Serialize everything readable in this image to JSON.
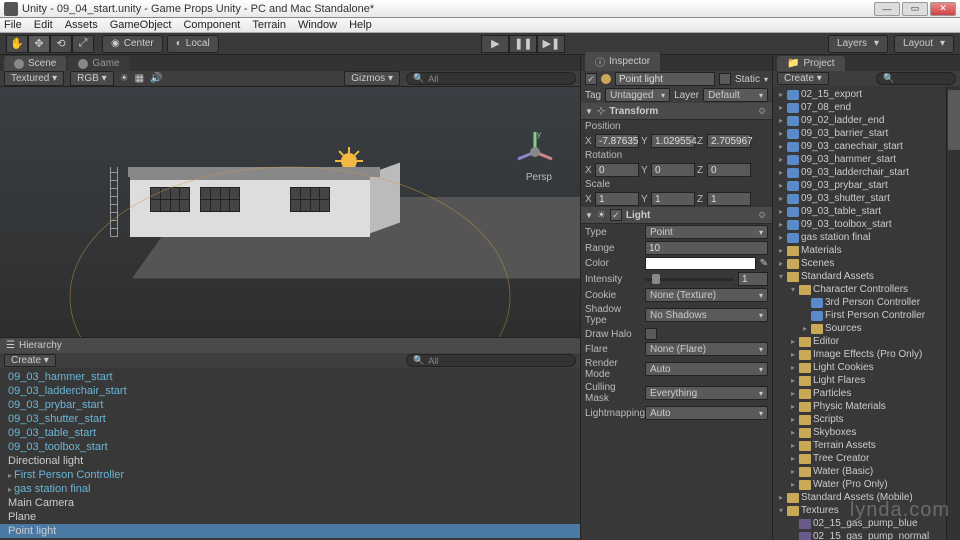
{
  "window": {
    "title": "Unity - 09_04_start.unity - Game Props Unity - PC and Mac Standalone*"
  },
  "menu": [
    "File",
    "Edit",
    "Assets",
    "GameObject",
    "Component",
    "Terrain",
    "Window",
    "Help"
  ],
  "toolbar": {
    "center": "Center",
    "local": "Local",
    "layers": "Layers",
    "layout": "Layout"
  },
  "scene": {
    "tab_scene": "Scene",
    "tab_game": "Game",
    "shading": "Textured",
    "rgb": "RGB",
    "gizmos": "Gizmos",
    "persp": "Persp"
  },
  "hierarchy": {
    "title": "Hierarchy",
    "create": "Create",
    "search_ph": "All",
    "items": [
      {
        "label": "09_03_hammer_start",
        "cls": "hitem"
      },
      {
        "label": "09_03_ladderchair_start",
        "cls": "hitem"
      },
      {
        "label": "09_03_prybar_start",
        "cls": "hitem"
      },
      {
        "label": "09_03_shutter_start",
        "cls": "hitem"
      },
      {
        "label": "09_03_table_start",
        "cls": "hitem"
      },
      {
        "label": "09_03_toolbox_start",
        "cls": "hitem"
      },
      {
        "label": "Directional light",
        "cls": "hitem gray"
      },
      {
        "label": "First Person Controller",
        "cls": "hitem exp"
      },
      {
        "label": "gas station final",
        "cls": "hitem exp"
      },
      {
        "label": "Main Camera",
        "cls": "hitem gray"
      },
      {
        "label": "Plane",
        "cls": "hitem gray"
      },
      {
        "label": "Point light",
        "cls": "hitem gray sel"
      }
    ]
  },
  "inspector": {
    "title": "Inspector",
    "obj_name": "Point light",
    "static": "Static",
    "tag_lbl": "Tag",
    "tag": "Untagged",
    "layer_lbl": "Layer",
    "layer": "Default",
    "transform": {
      "title": "Transform",
      "position": "Position",
      "px": "-7.87635",
      "py": "1.029554",
      "pz": "2.705967",
      "rotation": "Rotation",
      "rx": "0",
      "ry": "0",
      "rz": "0",
      "scale": "Scale",
      "sx": "1",
      "sy": "1",
      "sz": "1"
    },
    "light": {
      "title": "Light",
      "type_lbl": "Type",
      "type": "Point",
      "range_lbl": "Range",
      "range": "10",
      "color_lbl": "Color",
      "intensity_lbl": "Intensity",
      "intensity": "1",
      "cookie_lbl": "Cookie",
      "cookie": "None (Texture)",
      "shadow_lbl": "Shadow Type",
      "shadow": "No Shadows",
      "halo_lbl": "Draw Halo",
      "flare_lbl": "Flare",
      "flare": "None (Flare)",
      "render_lbl": "Render Mode",
      "render": "Auto",
      "cull_lbl": "Culling Mask",
      "cull": "Everything",
      "lm_lbl": "Lightmapping",
      "lm": "Auto"
    }
  },
  "project": {
    "title": "Project",
    "create": "Create",
    "search_ph": "",
    "items": [
      {
        "l": "02_15_export",
        "i": "prefab",
        "d": 0,
        "a": "col"
      },
      {
        "l": "07_08_end",
        "i": "prefab",
        "d": 0,
        "a": "col"
      },
      {
        "l": "09_02_ladder_end",
        "i": "prefab",
        "d": 0,
        "a": "col"
      },
      {
        "l": "09_03_barrier_start",
        "i": "prefab",
        "d": 0,
        "a": "col"
      },
      {
        "l": "09_03_canechair_start",
        "i": "prefab",
        "d": 0,
        "a": "col"
      },
      {
        "l": "09_03_hammer_start",
        "i": "prefab",
        "d": 0,
        "a": "col"
      },
      {
        "l": "09_03_ladderchair_start",
        "i": "prefab",
        "d": 0,
        "a": "col"
      },
      {
        "l": "09_03_prybar_start",
        "i": "prefab",
        "d": 0,
        "a": "col"
      },
      {
        "l": "09_03_shutter_start",
        "i": "prefab",
        "d": 0,
        "a": "col"
      },
      {
        "l": "09_03_table_start",
        "i": "prefab",
        "d": 0,
        "a": "col"
      },
      {
        "l": "09_03_toolbox_start",
        "i": "prefab",
        "d": 0,
        "a": "col"
      },
      {
        "l": "gas station final",
        "i": "prefab",
        "d": 0,
        "a": "col"
      },
      {
        "l": "Materials",
        "i": "folder",
        "d": 0,
        "a": "col"
      },
      {
        "l": "Scenes",
        "i": "folder",
        "d": 0,
        "a": "col"
      },
      {
        "l": "Standard Assets",
        "i": "folder",
        "d": 0,
        "a": "exp"
      },
      {
        "l": "Character Controllers",
        "i": "folder",
        "d": 1,
        "a": "exp"
      },
      {
        "l": "3rd Person Controller",
        "i": "prefab",
        "d": 2,
        "a": ""
      },
      {
        "l": "First Person Controller",
        "i": "prefab",
        "d": 2,
        "a": ""
      },
      {
        "l": "Sources",
        "i": "folder",
        "d": 2,
        "a": "col"
      },
      {
        "l": "Editor",
        "i": "folder",
        "d": 1,
        "a": "col"
      },
      {
        "l": "Image Effects (Pro Only)",
        "i": "folder",
        "d": 1,
        "a": "col"
      },
      {
        "l": "Light Cookies",
        "i": "folder",
        "d": 1,
        "a": "col"
      },
      {
        "l": "Light Flares",
        "i": "folder",
        "d": 1,
        "a": "col"
      },
      {
        "l": "Particles",
        "i": "folder",
        "d": 1,
        "a": "col"
      },
      {
        "l": "Physic Materials",
        "i": "folder",
        "d": 1,
        "a": "col"
      },
      {
        "l": "Scripts",
        "i": "folder",
        "d": 1,
        "a": "col"
      },
      {
        "l": "Skyboxes",
        "i": "folder",
        "d": 1,
        "a": "col"
      },
      {
        "l": "Terrain Assets",
        "i": "folder",
        "d": 1,
        "a": "col"
      },
      {
        "l": "Tree Creator",
        "i": "folder",
        "d": 1,
        "a": "col"
      },
      {
        "l": "Water (Basic)",
        "i": "folder",
        "d": 1,
        "a": "col"
      },
      {
        "l": "Water (Pro Only)",
        "i": "folder",
        "d": 1,
        "a": "col"
      },
      {
        "l": "Standard Assets (Mobile)",
        "i": "folder",
        "d": 0,
        "a": "col"
      },
      {
        "l": "Textures",
        "i": "folder",
        "d": 0,
        "a": "exp"
      },
      {
        "l": "02_15_gas_pump_blue",
        "i": "tex",
        "d": 1,
        "a": ""
      },
      {
        "l": "02_15_gas_pump_normal",
        "i": "tex",
        "d": 1,
        "a": ""
      }
    ]
  },
  "watermark": "lynda.com"
}
